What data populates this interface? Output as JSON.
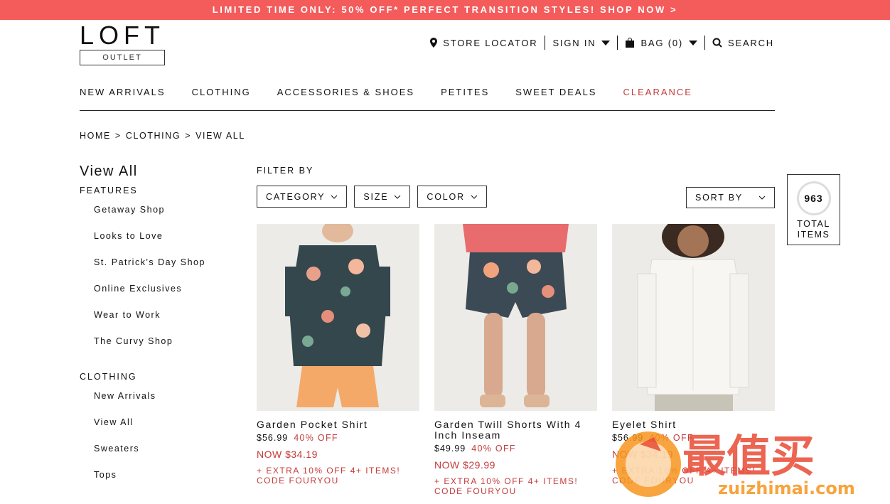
{
  "promo": "LIMITED TIME ONLY: 50% OFF* PERFECT TRANSITION STYLES! SHOP NOW >",
  "logo": {
    "word": "LOFT",
    "sub": "OUTLET"
  },
  "utility": {
    "store_locator": "STORE LOCATOR",
    "sign_in": "SIGN IN",
    "bag": "BAG (0)",
    "search": "SEARCH"
  },
  "nav": [
    "NEW ARRIVALS",
    "CLOTHING",
    "ACCESSORIES & SHOES",
    "PETITES",
    "SWEET DEALS",
    "CLEARANCE"
  ],
  "breadcrumb": [
    "HOME",
    ">",
    "CLOTHING",
    ">",
    "VIEW ALL"
  ],
  "sidebar": {
    "title": "View All",
    "features_label": "FEATURES",
    "features": [
      "Getaway Shop",
      "Looks to Love",
      "St. Patrick's Day Shop",
      "Online Exclusives",
      "Wear to Work",
      "The Curvy Shop"
    ],
    "clothing_label": "CLOTHING",
    "clothing": [
      "New Arrivals",
      "View All",
      "Sweaters",
      "Tops"
    ]
  },
  "filters": {
    "label": "FILTER BY",
    "category": "CATEGORY",
    "size": "SIZE",
    "color": "COLOR",
    "sort": "SORT BY"
  },
  "total": {
    "count": "963",
    "label1": "TOTAL",
    "label2": "ITEMS"
  },
  "products": [
    {
      "name": "Garden Pocket Shirt",
      "price": "$56.99",
      "off": "40% OFF",
      "now": "NOW $34.19",
      "extra1": "+ EXTRA 10% OFF 4+ ITEMS!",
      "extra2": "CODE FOURYOU"
    },
    {
      "name": "Garden Twill Shorts With 4 Inch Inseam",
      "price": "$49.99",
      "off": "40% OFF",
      "now": "NOW $29.99",
      "extra1": "+ EXTRA 10% OFF 4+ ITEMS!",
      "extra2": "CODE FOURYOU"
    },
    {
      "name": "Eyelet Shirt",
      "price": "$56.99",
      "off": "40% OFF",
      "now": "NOW $34.19",
      "extra1": "+ EXTRA 10% OFF 4+ ITEMS!",
      "extra2": "CODE FOURYOU"
    }
  ],
  "watermark": {
    "cn": "最值买",
    "url": "zuizhimai.com"
  },
  "colors": {
    "promo_bg": "#f45b5b",
    "accent_red": "#c43b3b"
  }
}
